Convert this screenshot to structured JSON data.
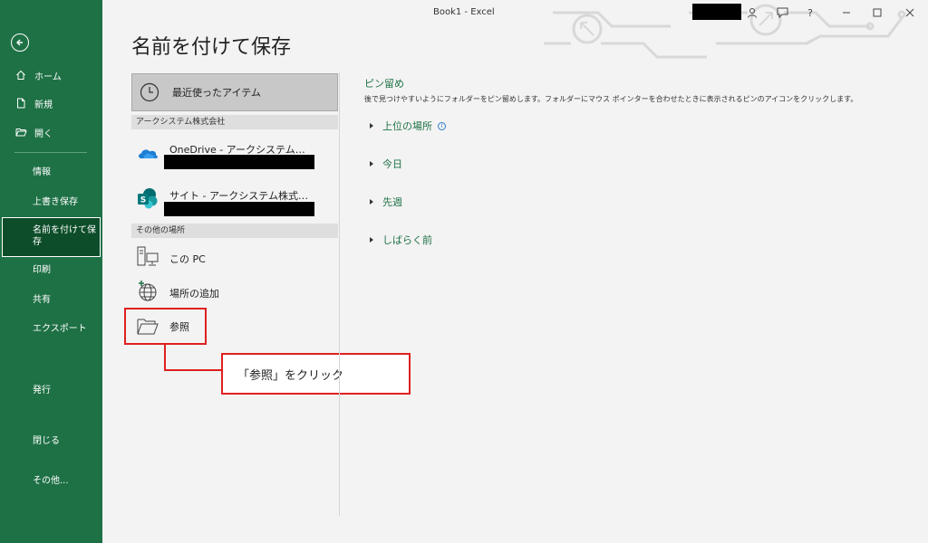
{
  "window": {
    "title": "Book1  -  Excel"
  },
  "sidebar": {
    "items": [
      {
        "label": "ホーム",
        "icon": "home-icon"
      },
      {
        "label": "新規",
        "icon": "new-file-icon"
      },
      {
        "label": "開く",
        "icon": "open-folder-icon"
      },
      {
        "label": "情報"
      },
      {
        "label": "上書き保存"
      },
      {
        "label": "名前を付けて保\n存"
      },
      {
        "label": "印刷"
      },
      {
        "label": "共有"
      },
      {
        "label": "エクスポート"
      },
      {
        "label": "発行"
      },
      {
        "label": "閉じる"
      },
      {
        "label": "その他..."
      }
    ]
  },
  "page": {
    "title": "名前を付けて保存"
  },
  "locations": {
    "recent_label": "最近使ったアイテム",
    "group1_header": "アークシステム株式会社",
    "onedrive_label": "OneDrive - アークシステム…",
    "sharepoint_label": "サイト - アークシステム株式…",
    "group2_header": "その他の場所",
    "this_pc_label": "この PC",
    "add_place_label": "場所の追加",
    "browse_label": "参照"
  },
  "annotation": {
    "callout_text": "「参照」をクリック"
  },
  "pinned": {
    "title": "ピン留め",
    "description": "後で見つけやすいようにフォルダーをピン留めします。フォルダーにマウス ポインターを合わせたときに表示されるピンのアイコンをクリックします。",
    "sections": [
      {
        "label": "上位の場所"
      },
      {
        "label": "今日"
      },
      {
        "label": "先週"
      },
      {
        "label": "しばらく前"
      }
    ]
  },
  "colors": {
    "sidebar_bg": "#1e7145",
    "accent_green": "#1e7145",
    "highlight_red": "#e02020"
  }
}
